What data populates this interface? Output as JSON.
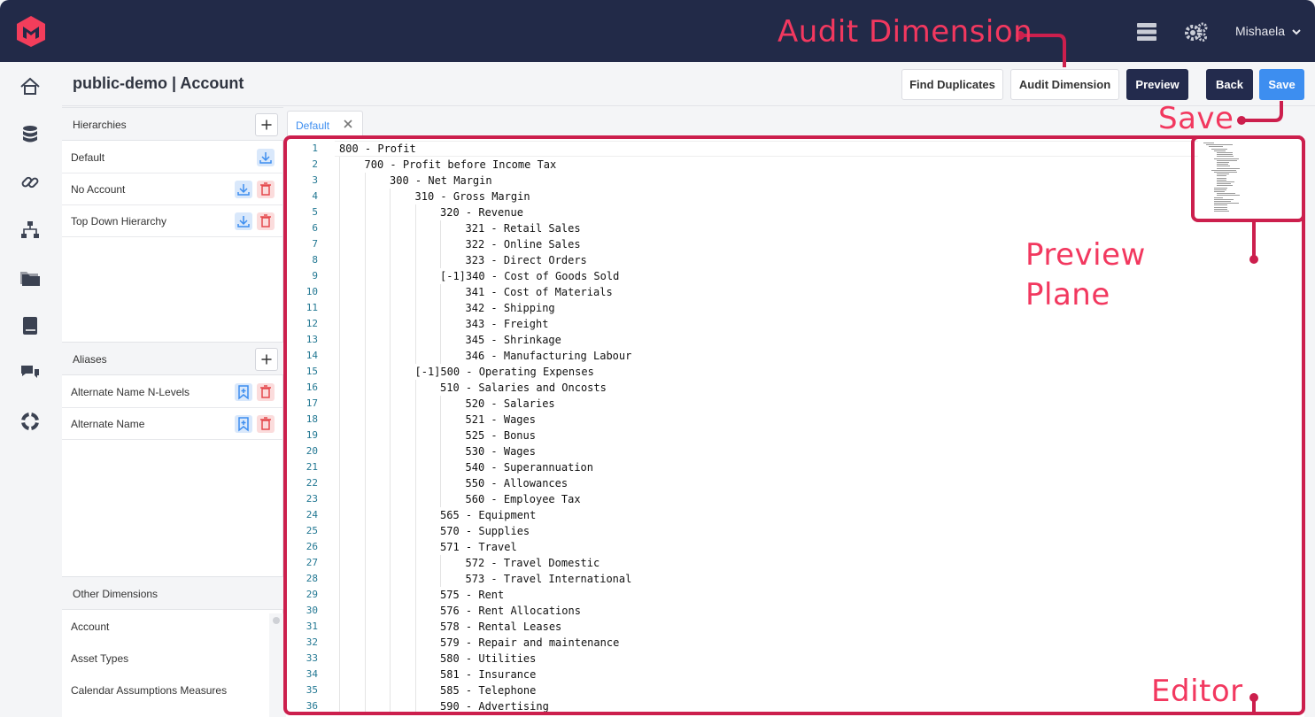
{
  "app": {
    "user_name": "Mishaela",
    "colors": {
      "topbar": "#222a48",
      "accent": "#3d8ef0",
      "dark_button": "#232b4d",
      "annotation": "#f2385f",
      "logo": "#f33d5b"
    }
  },
  "header": {
    "title": "public-demo | Account",
    "buttons": {
      "find_duplicates": "Find Duplicates",
      "audit_dimension": "Audit Dimension",
      "preview": "Preview",
      "back": "Back",
      "save": "Save"
    }
  },
  "nav_icons": [
    "home-icon",
    "database-icon",
    "link-icon",
    "hierarchy-icon",
    "folder-icon",
    "book-icon",
    "chat-icon",
    "lifebuoy-icon"
  ],
  "sidebar": {
    "hierarchies": {
      "title": "Hierarchies",
      "items": [
        {
          "label": "Default"
        },
        {
          "label": "No Account"
        },
        {
          "label": "Top Down Hierarchy"
        }
      ]
    },
    "aliases": {
      "title": "Aliases",
      "items": [
        {
          "label": "Alternate Name N-Levels"
        },
        {
          "label": "Alternate Name"
        }
      ]
    },
    "other_dimensions": {
      "title": "Other Dimensions",
      "items": [
        {
          "label": "Account"
        },
        {
          "label": "Asset Types"
        },
        {
          "label": "Calendar Assumptions Measures"
        }
      ]
    }
  },
  "tabs": [
    {
      "label": "Default"
    }
  ],
  "editor": {
    "lines": [
      {
        "n": "1",
        "depth": 0,
        "text": "800 - Profit"
      },
      {
        "n": "2",
        "depth": 1,
        "text": "700 - Profit before Income Tax"
      },
      {
        "n": "3",
        "depth": 2,
        "text": "300 - Net Margin"
      },
      {
        "n": "4",
        "depth": 3,
        "text": "310 - Gross Margin"
      },
      {
        "n": "5",
        "depth": 4,
        "text": "320 - Revenue"
      },
      {
        "n": "6",
        "depth": 5,
        "text": "321 - Retail Sales"
      },
      {
        "n": "7",
        "depth": 5,
        "text": "322 - Online Sales"
      },
      {
        "n": "8",
        "depth": 5,
        "text": "323 - Direct Orders"
      },
      {
        "n": "9",
        "depth": 4,
        "text": "[-1]340 - Cost of Goods Sold"
      },
      {
        "n": "10",
        "depth": 5,
        "text": "341 - Cost of Materials"
      },
      {
        "n": "11",
        "depth": 5,
        "text": "342 - Shipping"
      },
      {
        "n": "12",
        "depth": 5,
        "text": "343 - Freight"
      },
      {
        "n": "13",
        "depth": 5,
        "text": "345 - Shrinkage"
      },
      {
        "n": "14",
        "depth": 5,
        "text": "346 - Manufacturing Labour"
      },
      {
        "n": "15",
        "depth": 3,
        "text": "[-1]500 - Operating Expenses"
      },
      {
        "n": "16",
        "depth": 4,
        "text": "510 - Salaries and Oncosts"
      },
      {
        "n": "17",
        "depth": 5,
        "text": "520 - Salaries"
      },
      {
        "n": "18",
        "depth": 5,
        "text": "521 - Wages"
      },
      {
        "n": "19",
        "depth": 5,
        "text": "525 - Bonus"
      },
      {
        "n": "20",
        "depth": 5,
        "text": "530 - Wages"
      },
      {
        "n": "21",
        "depth": 5,
        "text": "540 - Superannuation"
      },
      {
        "n": "22",
        "depth": 5,
        "text": "550 - Allowances"
      },
      {
        "n": "23",
        "depth": 5,
        "text": "560 - Employee Tax"
      },
      {
        "n": "24",
        "depth": 4,
        "text": "565 - Equipment"
      },
      {
        "n": "25",
        "depth": 4,
        "text": "570 - Supplies"
      },
      {
        "n": "26",
        "depth": 4,
        "text": "571 - Travel"
      },
      {
        "n": "27",
        "depth": 5,
        "text": "572 - Travel Domestic"
      },
      {
        "n": "28",
        "depth": 5,
        "text": "573 - Travel International"
      },
      {
        "n": "29",
        "depth": 4,
        "text": "575 - Rent"
      },
      {
        "n": "30",
        "depth": 4,
        "text": "576 - Rent Allocations"
      },
      {
        "n": "31",
        "depth": 4,
        "text": "578 - Rental Leases"
      },
      {
        "n": "32",
        "depth": 4,
        "text": "579 - Repair and maintenance"
      },
      {
        "n": "33",
        "depth": 4,
        "text": "580 - Utilities"
      },
      {
        "n": "34",
        "depth": 4,
        "text": "581 - Insurance"
      },
      {
        "n": "35",
        "depth": 4,
        "text": "585 - Telephone"
      },
      {
        "n": "36",
        "depth": 4,
        "text": "590 - Advertising"
      }
    ]
  },
  "annotations": {
    "audit_dimension": "Audit Dimension",
    "save": "Save",
    "preview_plane_line1": "Preview",
    "preview_plane_line2": "Plane",
    "editor": "Editor"
  }
}
